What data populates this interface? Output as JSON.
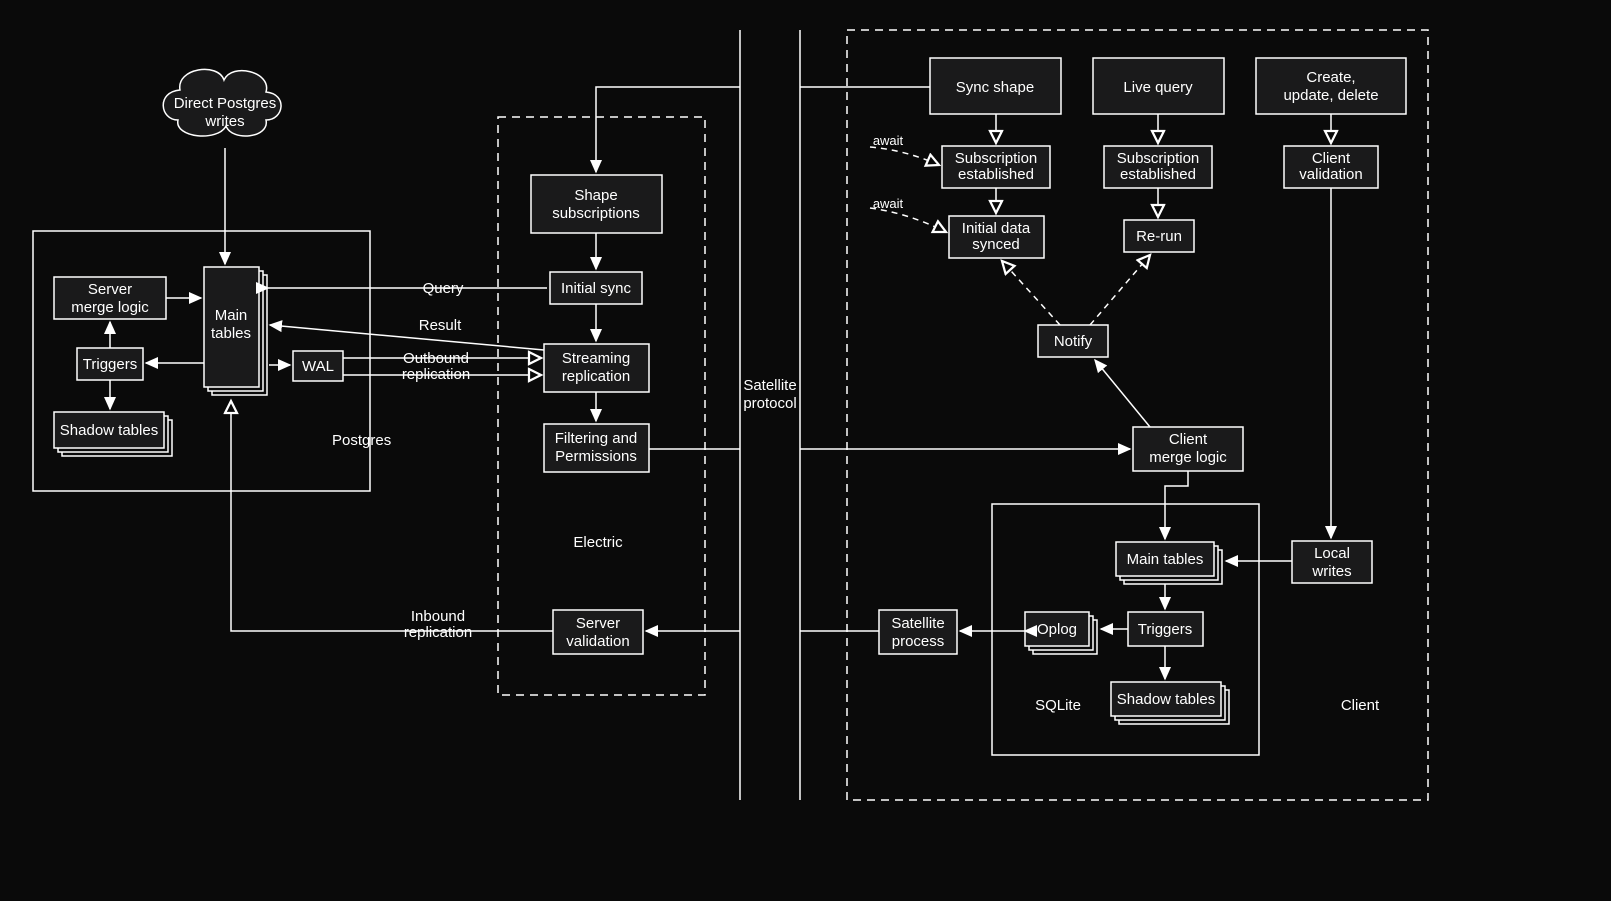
{
  "postgres": {
    "title": "Postgres",
    "cloud": "Direct Postgres writes",
    "server_merge_logic": "Server merge logic",
    "triggers": "Triggers",
    "shadow_tables": "Shadow tables",
    "main_tables": "Main tables",
    "wal": "WAL"
  },
  "electric": {
    "title": "Electric",
    "shape_subscriptions": "Shape subscriptions",
    "initial_sync": "Initial sync",
    "streaming_replication": "Streaming replication",
    "filtering_permissions": "Filtering and Permissions",
    "server_validation": "Server validation"
  },
  "labels": {
    "query": "Query",
    "result": "Result",
    "outbound_replication": "Outbound replication",
    "inbound_replication": "Inbound replication",
    "satellite_protocol": "Satellite protocol",
    "await1": "await",
    "await2": "await"
  },
  "client": {
    "title": "Client",
    "sync_shape": "Sync shape",
    "live_query": "Live query",
    "create_update_delete": "Create, update, delete",
    "subscription_established_1": "Subscription established",
    "subscription_established_2": "Subscription established",
    "client_validation": "Client validation",
    "initial_data_synced": "Initial data synced",
    "rerun": "Re-run",
    "notify": "Notify",
    "client_merge_logic": "Client merge logic",
    "local_writes": "Local writes",
    "satellite_process": "Satellite process"
  },
  "sqlite": {
    "title": "SQLite",
    "main_tables": "Main tables",
    "oplog": "Oplog",
    "triggers": "Triggers",
    "shadow_tables": "Shadow tables"
  }
}
